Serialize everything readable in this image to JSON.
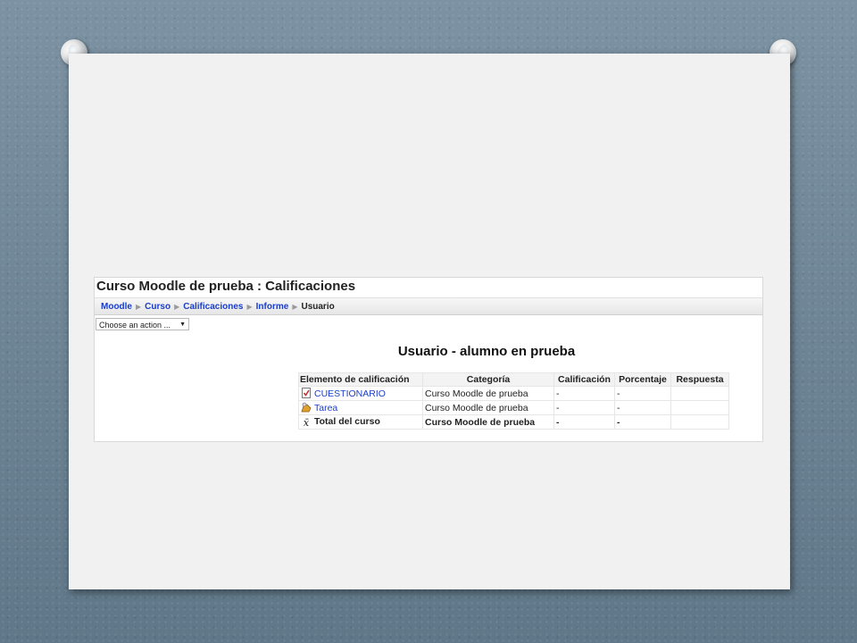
{
  "page": {
    "title": "Curso Moodle de prueba : Calificaciones"
  },
  "breadcrumb": {
    "items": [
      "Moodle",
      "Curso",
      "Calificaciones",
      "Informe"
    ],
    "current": "Usuario"
  },
  "action_select": {
    "value": "Choose an action ..."
  },
  "report": {
    "heading": "Usuario - alumno en prueba",
    "columns": [
      "Elemento de calificación",
      "Categoría",
      "Calificación",
      "Porcentaje",
      "Respuesta"
    ],
    "rows": [
      {
        "item": "CUESTIONARIO",
        "icon": "quiz-icon",
        "category": "Curso Moodle de prueba",
        "grade": "-",
        "percentage": "-",
        "feedback": "",
        "link": true
      },
      {
        "item": "Tarea",
        "icon": "assignment-icon",
        "category": "Curso Moodle de prueba",
        "grade": "-",
        "percentage": "-",
        "feedback": "",
        "link": true
      },
      {
        "item": "Total del curso",
        "icon": "total-icon",
        "category": "Curso Moodle de prueba",
        "grade": "-",
        "percentage": "-",
        "feedback": "",
        "link": false
      }
    ]
  },
  "colors": {
    "link": "#1a3ec9",
    "slide_background": "#f1f1f1",
    "backdrop": "#6b8395"
  }
}
